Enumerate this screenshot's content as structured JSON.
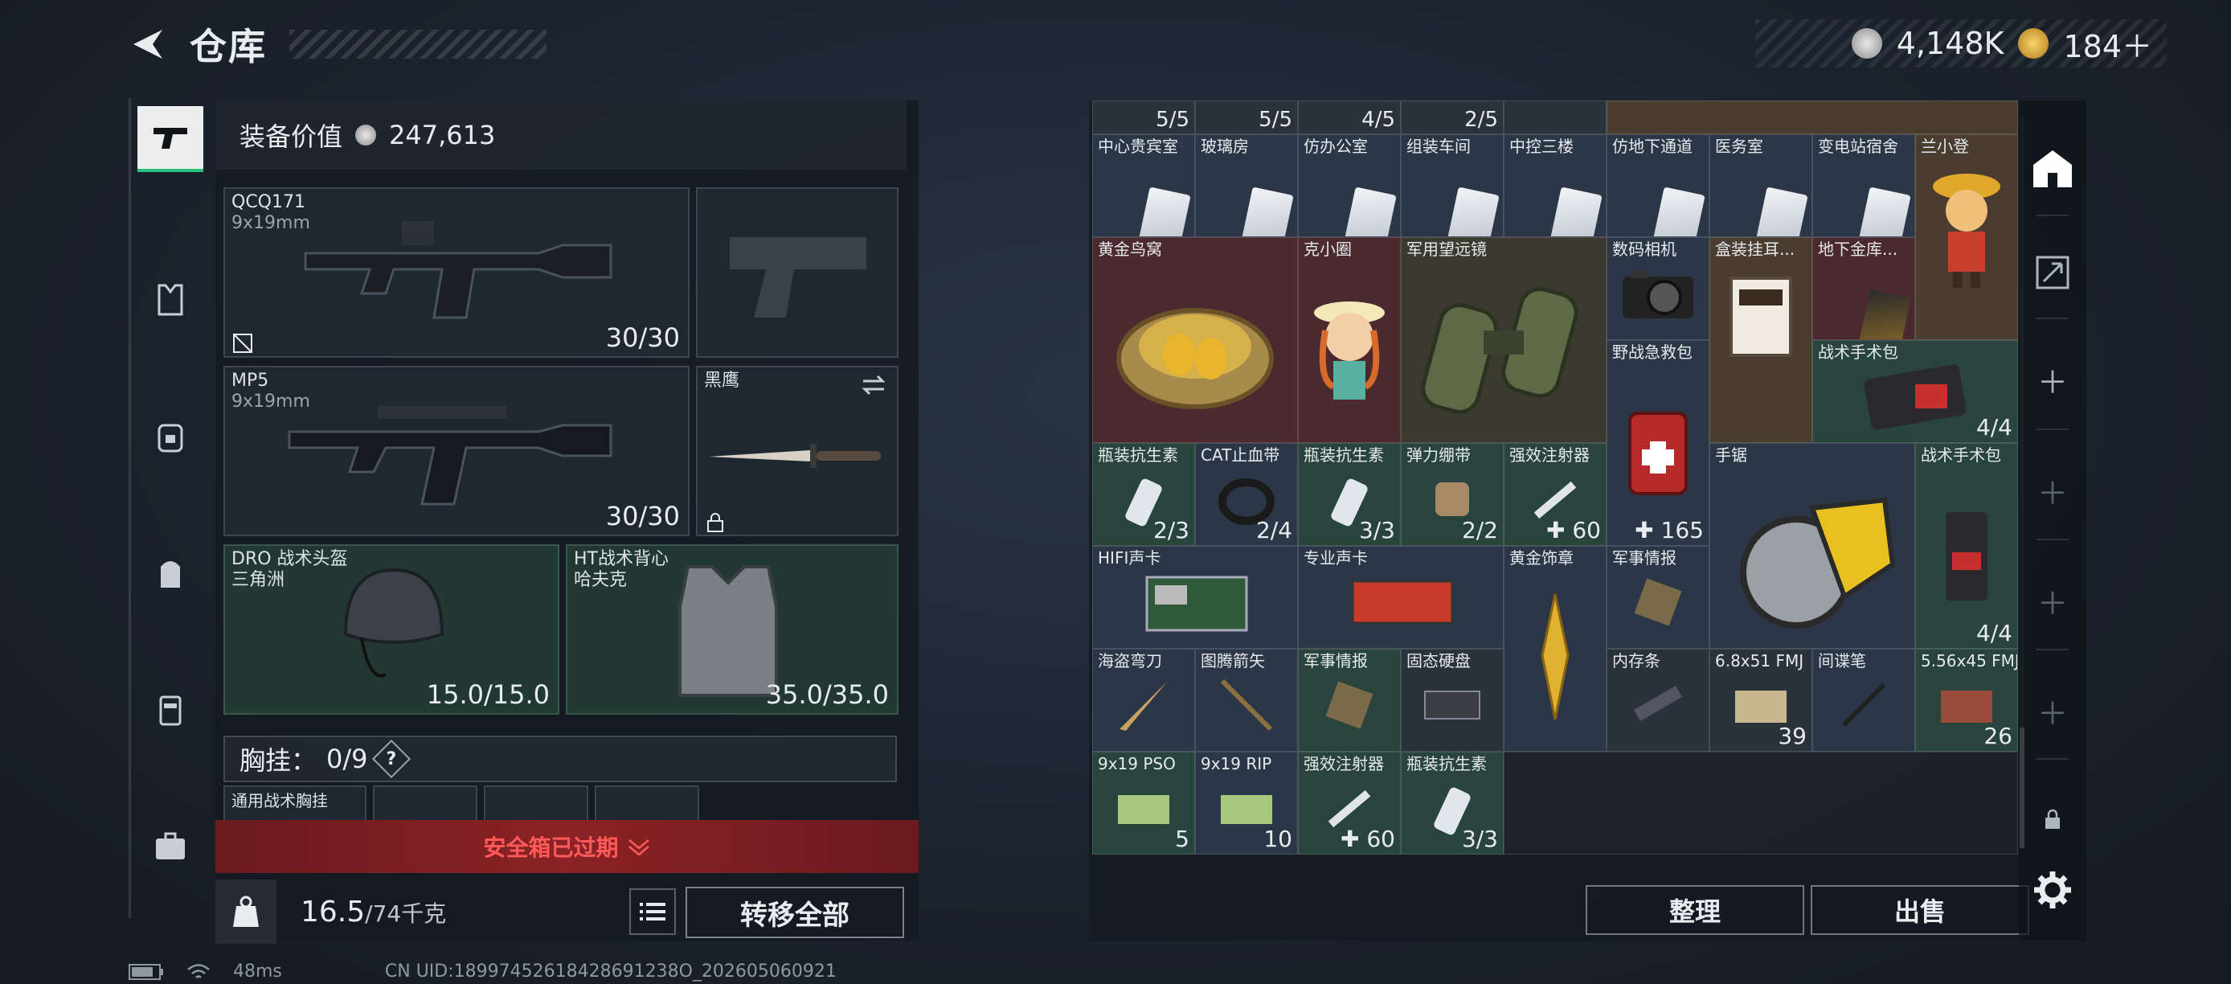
{
  "header": {
    "title": "仓库"
  },
  "currency": {
    "silver": "4,148K",
    "gold": "184＋"
  },
  "left_nav": [
    "gun-icon",
    "armor-icon",
    "chest-rig-icon",
    "backpack-icon",
    "pouch-icon",
    "briefcase-icon"
  ],
  "equip": {
    "label": "装备价值",
    "value": "247,613",
    "primary1": {
      "name": "QCQ171",
      "ammo": "9x19mm",
      "count": "30/30"
    },
    "primary2": {
      "name": "MP5",
      "ammo": "9x19mm",
      "count": "30/30"
    },
    "melee": {
      "name": "黑鹰"
    },
    "helmet": {
      "name": "DRO 战术头盔",
      "sub": "三角洲",
      "count": "15.0/15.0"
    },
    "vest": {
      "name": "HT战术背心",
      "sub": "哈夫克",
      "count": "35.0/35.0"
    },
    "chest": {
      "label": "胸挂：",
      "count": "0/9",
      "q": "?"
    },
    "chest_slot": {
      "name": "通用战术胸挂"
    }
  },
  "safe_box": {
    "text": "安全箱已过期"
  },
  "weight": {
    "current": "16.5",
    "max": "/74千克"
  },
  "transfer_all": "转移全部",
  "footer": {
    "ping": "48ms",
    "uid": "CN UID:18997452618428691238O_202605060921"
  },
  "stash": {
    "top_counts": [
      "5/5",
      "5/5",
      "4/5",
      "2/5"
    ],
    "cards": [
      "中心贵宾室",
      "玻璃房",
      "仿办公室",
      "组装车间",
      "中控三楼",
      "仿地下通道",
      "医务室",
      "变电站宿舍"
    ],
    "lanxiaodeng": "兰小登",
    "gold_nest": "黄金鸟窝",
    "kexiaoquan": "克小圈",
    "binocular": "军用望远镜",
    "camera": "数码相机",
    "boxed": "盒装挂耳...",
    "underground": "地下金库...",
    "first_aid": {
      "name": "野战急救包",
      "count": "165"
    },
    "surgery1": {
      "name": "战术手术包",
      "count": "4/4"
    },
    "row3": [
      {
        "name": "瓶装抗生素",
        "count": "2/3"
      },
      {
        "name": "CAT止血带",
        "count": "2/4"
      },
      {
        "name": "瓶装抗生素",
        "count": "3/3"
      },
      {
        "name": "弹力绷带",
        "count": "2/2"
      },
      {
        "name": "强效注射器",
        "count": "60"
      }
    ],
    "saw": "手锯",
    "surgery2": {
      "name": "战术手术包",
      "count": "4/4"
    },
    "hifi": "HIFI声卡",
    "pro_card": "专业声卡",
    "gold_badge": "黄金饰章",
    "intel1": "军事情报",
    "row5": [
      {
        "name": "海盗弯刀"
      },
      {
        "name": "图腾箭矢"
      },
      {
        "name": "军事情报"
      },
      {
        "name": "固态硬盘"
      },
      {
        "name": "内存条"
      },
      {
        "name": "6.8x51 FMJ",
        "count": "39"
      },
      {
        "name": "间谍笔"
      },
      {
        "name": "5.56x45 FMJ",
        "count": "26"
      }
    ],
    "row6": [
      {
        "name": "9x19 PSO",
        "count": "5"
      },
      {
        "name": "9x19 RIP",
        "count": "10"
      },
      {
        "name": "强效注射器",
        "count": "60"
      },
      {
        "name": "瓶装抗生素",
        "count": "3/3"
      }
    ]
  },
  "actions": {
    "sort": "整理",
    "sell": "出售"
  }
}
